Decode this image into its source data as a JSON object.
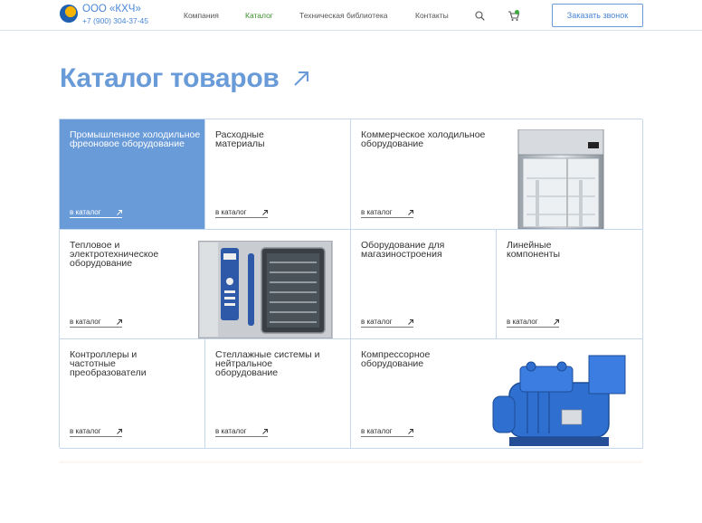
{
  "header": {
    "company_name": "ООО «КХЧ»",
    "company_phone": "+7 (900) 304-37-45",
    "nav": [
      {
        "label": "Компания",
        "active": false
      },
      {
        "label": "Каталог",
        "active": true
      },
      {
        "label": "Техническая библиотека",
        "active": false
      },
      {
        "label": "Контакты",
        "active": false
      }
    ],
    "icons": [
      "search-icon",
      "cart-icon"
    ],
    "call_button": "Заказать звонок"
  },
  "page": {
    "title": "Каталог товаров"
  },
  "catalog": {
    "link_label": "в каталог",
    "items": [
      {
        "title": "Промышленное холодильное фреоновое оборудование",
        "active": true
      },
      {
        "title": "Расходные материалы"
      },
      {
        "title": "Коммерческое холодильное оборудование",
        "image": "commercial-fridge-image"
      },
      {
        "title": "Тепловое и электротехническое оборудование",
        "image": "combi-oven-image"
      },
      {
        "title": "Оборудование для магазиностроения"
      },
      {
        "title": "Линейные компоненты"
      },
      {
        "title": "Контроллеры и частотные преобразователи"
      },
      {
        "title": "Стеллажные системы и нейтральное оборудование"
      },
      {
        "title": "Компрессорное оборудование",
        "image": "compressor-image"
      }
    ]
  },
  "colors": {
    "accent": "#6a9bd9",
    "nav_active": "#3c8d2f",
    "grid_border": "#c5d7ec"
  }
}
